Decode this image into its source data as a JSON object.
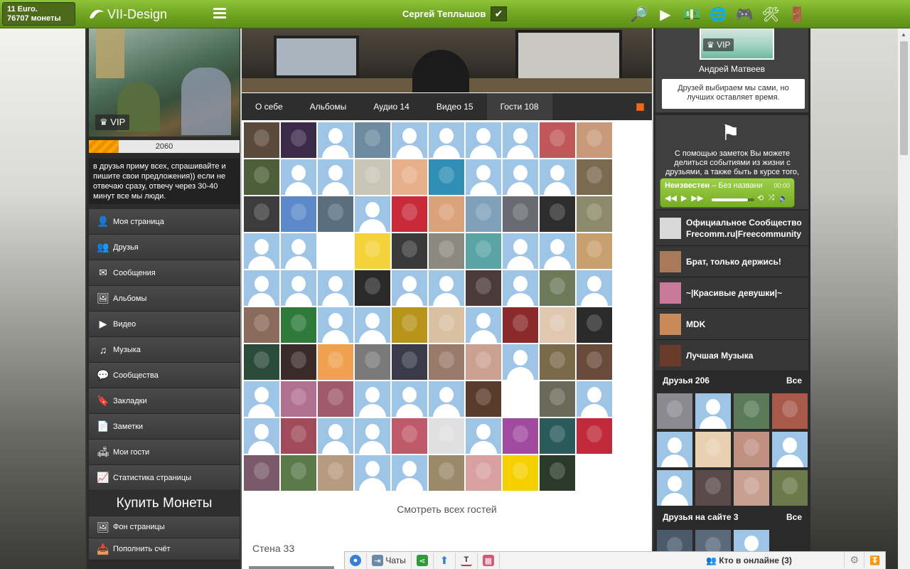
{
  "topbar": {
    "coins_line1": "11 Euro.",
    "coins_line2": "76707 монеты",
    "logo_text": "VII-Design",
    "username": "Сергей Теплышов",
    "verified_glyph": "✔",
    "icons": [
      {
        "name": "search-icon",
        "glyph": "🔎"
      },
      {
        "name": "play-icon",
        "glyph": "▶"
      },
      {
        "name": "wallet-icon",
        "glyph": "💵"
      },
      {
        "name": "globe-icon",
        "glyph": "🌐"
      },
      {
        "name": "gamepad-icon",
        "glyph": "🎮"
      },
      {
        "name": "tools-icon",
        "glyph": "🛠"
      },
      {
        "name": "logout-icon",
        "glyph": "🚪"
      }
    ]
  },
  "left": {
    "vip_label": "VIP",
    "level_value": "2060",
    "level_fill_fraction": 0.2,
    "status_text": "в друзья приму всех, спрашивайте и пишите свои предложения)) если не отвечаю сразу, отвечу через 30-40 минут все мы люди.",
    "menu": [
      {
        "name": "menu-my-page",
        "label": "Моя страница",
        "icon": "👤"
      },
      {
        "name": "menu-friends",
        "label": "Друзья",
        "icon": "👥"
      },
      {
        "name": "menu-messages",
        "label": "Сообщения",
        "icon": "✉"
      },
      {
        "name": "menu-albums",
        "label": "Альбомы",
        "icon": "🖼"
      },
      {
        "name": "menu-video",
        "label": "Видео",
        "icon": "▶"
      },
      {
        "name": "menu-music",
        "label": "Музыка",
        "icon": "♫"
      },
      {
        "name": "menu-communities",
        "label": "Сообщества",
        "icon": "💬"
      },
      {
        "name": "menu-bookmarks",
        "label": "Закладки",
        "icon": "🔖"
      },
      {
        "name": "menu-notes",
        "label": "Заметки",
        "icon": "📄"
      },
      {
        "name": "menu-my-guests",
        "label": "Мои гости",
        "icon": "🛋"
      },
      {
        "name": "menu-page-stats",
        "label": "Статистика страницы",
        "icon": "📈"
      }
    ],
    "buy_coins": "Купить Монеты",
    "menu2": [
      {
        "name": "menu-page-background",
        "label": "Фон страницы",
        "icon": "🖼"
      },
      {
        "name": "menu-top-up",
        "label": "Пополнить счёт",
        "icon": "📥"
      }
    ]
  },
  "tabs": [
    {
      "name": "tab-about",
      "label": "О себе"
    },
    {
      "name": "tab-albums",
      "label": "Альбомы"
    },
    {
      "name": "tab-audio",
      "label": "Аудио 14"
    },
    {
      "name": "tab-video",
      "label": "Видео 15"
    },
    {
      "name": "tab-guests",
      "label": "Гости 108",
      "active": true
    }
  ],
  "guests_grid": [
    [
      "#5b4a3c",
      "#3b2a4a",
      "d",
      "#6c8aa0",
      "d",
      "d",
      "d",
      "d",
      "#c0585a",
      "#c89a7a"
    ],
    [
      "#4d5f3a",
      "d",
      "d",
      "#c9c6b8",
      "#e7b08a",
      "#2f8fb4",
      "d",
      "d",
      "d",
      "#7a6a50"
    ],
    [
      "#3c3c3c",
      "#5c89c9",
      "#5a6e7e",
      "d",
      "#c92a3a",
      "#d9a27a",
      "#7fa0b8",
      "#6a6a72",
      "#2e2e2e",
      "#8c8a6a"
    ],
    [
      "d",
      "d",
      "#ffffff",
      "#f5d23a",
      "#3a3a3a",
      "#8a8a80",
      "#5aa4a6",
      "d",
      "d",
      "#c8a070"
    ],
    [
      "d",
      "d",
      "d",
      "#2a2a2a",
      "d",
      "d",
      "#4a3a3a",
      "d",
      "#6c7a5a",
      "d"
    ],
    [
      "#8a6a5a",
      "#2e7a3a",
      "d",
      "d",
      "#b8941a",
      "#d8c0a0",
      "d",
      "#8a2a2a",
      "#e0c8b0",
      "#2a2a2a"
    ],
    [
      "#2a4a3a",
      "#3a2a2a",
      "#f0a050",
      "#7a7a7a",
      "#3a3a4a",
      "#9a7a6a",
      "#caa090",
      "d",
      "#7a6a4a",
      "#6a4a3a"
    ],
    [
      "d",
      "#b07090",
      "#a05a6a",
      "d",
      "d",
      "d",
      "#5a3a2a",
      "#ffffff",
      "#6a6a5a",
      "d"
    ],
    [
      "d",
      "#a04a5a",
      "d",
      "d",
      "#c05a6a",
      "#e0e0e0",
      "d",
      "#a04aa0",
      "#2a5a5a",
      "#c02a3a"
    ],
    [
      "#7a5a6a",
      "#5a7a4a",
      "#b89a80",
      "d",
      "d",
      "#9a8a6a",
      "#d8a0a0",
      "#f5d000",
      "#2a3a2a",
      null
    ]
  ],
  "see_all_guests": "Смотреть всех гостей",
  "wall_label": "Стена 33",
  "right": {
    "vip_label": "VIP",
    "friend_name": "Андрей Матвеев",
    "friend_status": "Друзей выбираем мы сами, но лучших оставляет время.",
    "notes_text": "С помощью заметок Вы можете делиться событиями из жизни с друзьями, а также быть в курсе того,",
    "player": {
      "artist": "Неизвестен",
      "title": " – Без названи",
      "time": "00:00",
      "progress_fraction": 0.85
    },
    "groups": [
      {
        "name": "group-frecomm",
        "label": "Официальное Сообщество Frecomm.ru|Freecommunity",
        "color": "#d8d8d8",
        "tall": true
      },
      {
        "name": "group-brat",
        "label": "Брат, только держись!",
        "color": "#a87a5a"
      },
      {
        "name": "group-girls",
        "label": "~|Красивые девушки|~",
        "color": "#c97a9a"
      },
      {
        "name": "group-mdk",
        "label": "MDK",
        "color": "#c98a5a"
      },
      {
        "name": "group-music",
        "label": "Лучшая Музыка",
        "color": "#6a3a2a"
      }
    ],
    "friends_label": "Друзья 206",
    "friends_all": "Все",
    "friends_grid": [
      "#8a8a90",
      "d",
      "#5a7a5a",
      "#a85a4a",
      "d",
      "#e8d0b0",
      "#c09080",
      "d",
      "d",
      "#5a4a4a",
      "#c8a090",
      "#6a7a4a"
    ],
    "online_label": "Друзья на сайте 3",
    "online_all": "Все",
    "online_grid": [
      "#4a5a6a",
      "#5a6a7a",
      "d"
    ]
  },
  "bottombar": {
    "chats_label": "Чаты",
    "online_label": "Кто в онлайне (3)"
  }
}
